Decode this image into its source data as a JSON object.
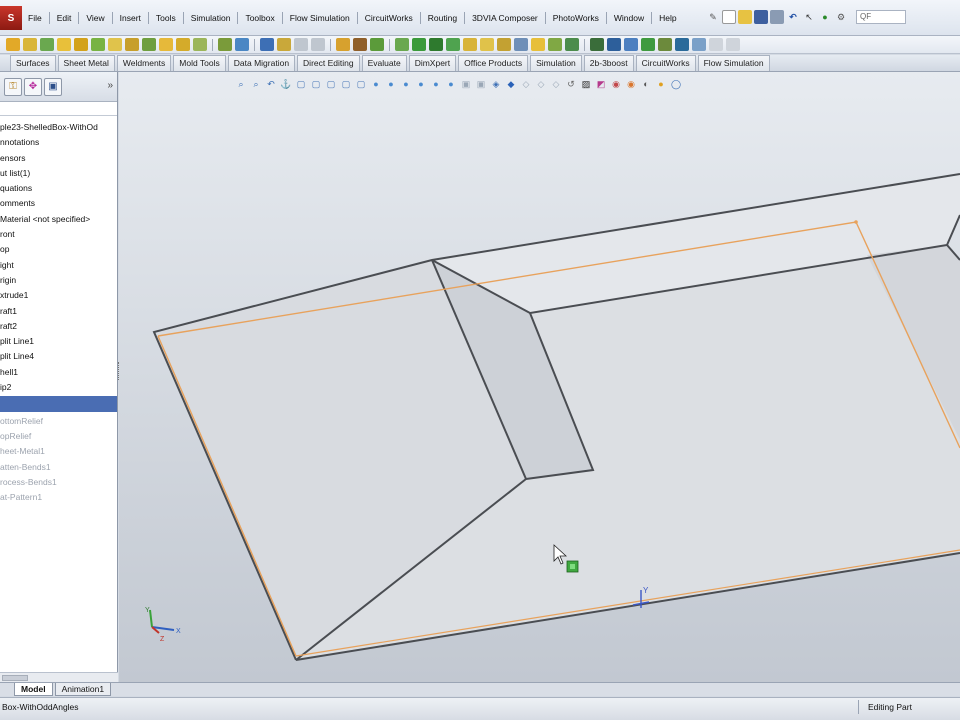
{
  "app": {
    "logo": "S",
    "menus": [
      "File",
      "Edit",
      "View",
      "Insert",
      "Tools",
      "Simulation",
      "Toolbox",
      "Flow Simulation",
      "CircuitWorks",
      "Routing",
      "3DVIA Composer",
      "PhotoWorks",
      "Window",
      "Help"
    ],
    "search_placeholder": "QF"
  },
  "command_tabs": [
    "Surfaces",
    "Sheet Metal",
    "Weldments",
    "Mold Tools",
    "Data Migration",
    "Direct Editing",
    "Evaluate",
    "DimXpert",
    "Office Products",
    "Simulation",
    "2b-3boost",
    "CircuitWorks",
    "Flow Simulation"
  ],
  "feature_tree": {
    "active": [
      "ple23-ShelledBox-WithOd",
      "nnotations",
      "ensors",
      "ut list(1)",
      "quations",
      "omments",
      "Material <not specified>",
      "ront",
      "op",
      "ight",
      "rigin",
      "xtrude1",
      "raft1",
      "raft2",
      "plit Line1",
      "plit Line4",
      "hell1",
      "ip2"
    ],
    "suppressed": [
      "ottomRelief",
      "opRelief",
      "heet-Metal1",
      "atten-Bends1",
      "rocess-Bends1",
      "at-Pattern1"
    ]
  },
  "viewport": {
    "triad": {
      "x": "X",
      "y": "Y",
      "z": "Z"
    },
    "origin_label": "Y"
  },
  "model_tabs": [
    {
      "label": "Model",
      "active": true
    },
    {
      "label": "Animation1",
      "active": false
    }
  ],
  "status": {
    "left": "Box-WithOddAngles",
    "right": "Editing Part"
  },
  "colors": {
    "split_line": "#e8a25c",
    "edges": "#4a4d52",
    "face": "#dcdfe4"
  }
}
